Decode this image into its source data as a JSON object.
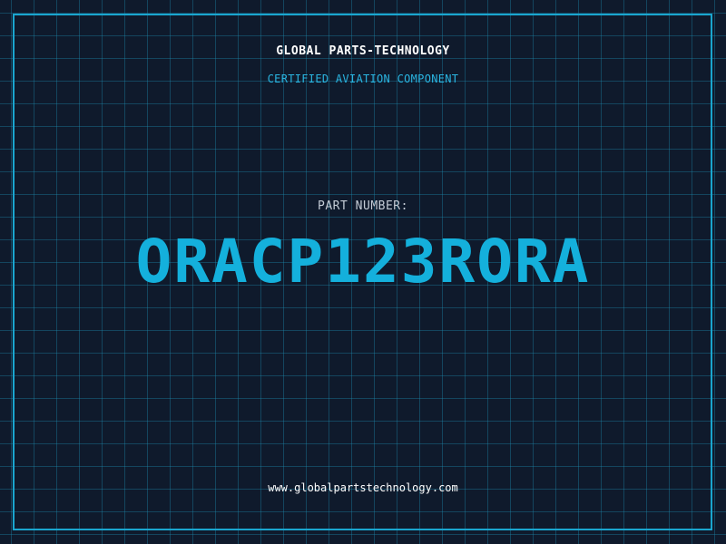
{
  "header": {
    "company": "GLOBAL PARTS-TECHNOLOGY",
    "subtitle": "CERTIFIED AVIATION COMPONENT"
  },
  "part": {
    "label": "PART NUMBER:",
    "number": "ORACP123RORA"
  },
  "footer": {
    "website": "www.globalpartstechnology.com"
  },
  "colors": {
    "background": "#0f1a2c",
    "grid": "#1e8caf",
    "accent": "#14b0dc",
    "frame": "#1aa6cf",
    "text": "#ffffff"
  }
}
